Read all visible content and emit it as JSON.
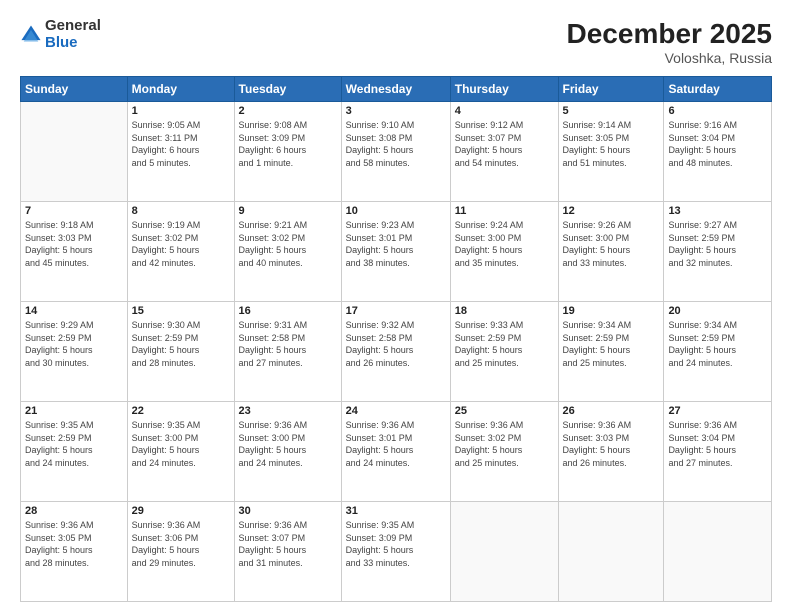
{
  "logo": {
    "general": "General",
    "blue": "Blue"
  },
  "header": {
    "month": "December 2025",
    "location": "Voloshka, Russia"
  },
  "weekdays": [
    "Sunday",
    "Monday",
    "Tuesday",
    "Wednesday",
    "Thursday",
    "Friday",
    "Saturday"
  ],
  "weeks": [
    [
      {
        "day": "",
        "info": ""
      },
      {
        "day": "1",
        "info": "Sunrise: 9:05 AM\nSunset: 3:11 PM\nDaylight: 6 hours\nand 5 minutes."
      },
      {
        "day": "2",
        "info": "Sunrise: 9:08 AM\nSunset: 3:09 PM\nDaylight: 6 hours\nand 1 minute."
      },
      {
        "day": "3",
        "info": "Sunrise: 9:10 AM\nSunset: 3:08 PM\nDaylight: 5 hours\nand 58 minutes."
      },
      {
        "day": "4",
        "info": "Sunrise: 9:12 AM\nSunset: 3:07 PM\nDaylight: 5 hours\nand 54 minutes."
      },
      {
        "day": "5",
        "info": "Sunrise: 9:14 AM\nSunset: 3:05 PM\nDaylight: 5 hours\nand 51 minutes."
      },
      {
        "day": "6",
        "info": "Sunrise: 9:16 AM\nSunset: 3:04 PM\nDaylight: 5 hours\nand 48 minutes."
      }
    ],
    [
      {
        "day": "7",
        "info": "Sunrise: 9:18 AM\nSunset: 3:03 PM\nDaylight: 5 hours\nand 45 minutes."
      },
      {
        "day": "8",
        "info": "Sunrise: 9:19 AM\nSunset: 3:02 PM\nDaylight: 5 hours\nand 42 minutes."
      },
      {
        "day": "9",
        "info": "Sunrise: 9:21 AM\nSunset: 3:02 PM\nDaylight: 5 hours\nand 40 minutes."
      },
      {
        "day": "10",
        "info": "Sunrise: 9:23 AM\nSunset: 3:01 PM\nDaylight: 5 hours\nand 38 minutes."
      },
      {
        "day": "11",
        "info": "Sunrise: 9:24 AM\nSunset: 3:00 PM\nDaylight: 5 hours\nand 35 minutes."
      },
      {
        "day": "12",
        "info": "Sunrise: 9:26 AM\nSunset: 3:00 PM\nDaylight: 5 hours\nand 33 minutes."
      },
      {
        "day": "13",
        "info": "Sunrise: 9:27 AM\nSunset: 2:59 PM\nDaylight: 5 hours\nand 32 minutes."
      }
    ],
    [
      {
        "day": "14",
        "info": "Sunrise: 9:29 AM\nSunset: 2:59 PM\nDaylight: 5 hours\nand 30 minutes."
      },
      {
        "day": "15",
        "info": "Sunrise: 9:30 AM\nSunset: 2:59 PM\nDaylight: 5 hours\nand 28 minutes."
      },
      {
        "day": "16",
        "info": "Sunrise: 9:31 AM\nSunset: 2:58 PM\nDaylight: 5 hours\nand 27 minutes."
      },
      {
        "day": "17",
        "info": "Sunrise: 9:32 AM\nSunset: 2:58 PM\nDaylight: 5 hours\nand 26 minutes."
      },
      {
        "day": "18",
        "info": "Sunrise: 9:33 AM\nSunset: 2:59 PM\nDaylight: 5 hours\nand 25 minutes."
      },
      {
        "day": "19",
        "info": "Sunrise: 9:34 AM\nSunset: 2:59 PM\nDaylight: 5 hours\nand 25 minutes."
      },
      {
        "day": "20",
        "info": "Sunrise: 9:34 AM\nSunset: 2:59 PM\nDaylight: 5 hours\nand 24 minutes."
      }
    ],
    [
      {
        "day": "21",
        "info": "Sunrise: 9:35 AM\nSunset: 2:59 PM\nDaylight: 5 hours\nand 24 minutes."
      },
      {
        "day": "22",
        "info": "Sunrise: 9:35 AM\nSunset: 3:00 PM\nDaylight: 5 hours\nand 24 minutes."
      },
      {
        "day": "23",
        "info": "Sunrise: 9:36 AM\nSunset: 3:00 PM\nDaylight: 5 hours\nand 24 minutes."
      },
      {
        "day": "24",
        "info": "Sunrise: 9:36 AM\nSunset: 3:01 PM\nDaylight: 5 hours\nand 24 minutes."
      },
      {
        "day": "25",
        "info": "Sunrise: 9:36 AM\nSunset: 3:02 PM\nDaylight: 5 hours\nand 25 minutes."
      },
      {
        "day": "26",
        "info": "Sunrise: 9:36 AM\nSunset: 3:03 PM\nDaylight: 5 hours\nand 26 minutes."
      },
      {
        "day": "27",
        "info": "Sunrise: 9:36 AM\nSunset: 3:04 PM\nDaylight: 5 hours\nand 27 minutes."
      }
    ],
    [
      {
        "day": "28",
        "info": "Sunrise: 9:36 AM\nSunset: 3:05 PM\nDaylight: 5 hours\nand 28 minutes."
      },
      {
        "day": "29",
        "info": "Sunrise: 9:36 AM\nSunset: 3:06 PM\nDaylight: 5 hours\nand 29 minutes."
      },
      {
        "day": "30",
        "info": "Sunrise: 9:36 AM\nSunset: 3:07 PM\nDaylight: 5 hours\nand 31 minutes."
      },
      {
        "day": "31",
        "info": "Sunrise: 9:35 AM\nSunset: 3:09 PM\nDaylight: 5 hours\nand 33 minutes."
      },
      {
        "day": "",
        "info": ""
      },
      {
        "day": "",
        "info": ""
      },
      {
        "day": "",
        "info": ""
      }
    ]
  ]
}
